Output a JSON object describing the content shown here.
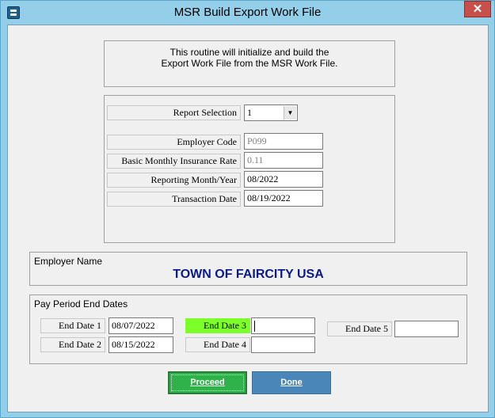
{
  "window": {
    "title": "MSR Build Export Work File",
    "close_glyph": "✕"
  },
  "info": {
    "line1": "This routine will initialize and build the",
    "line2": "Export Work File from the MSR Work File."
  },
  "form": {
    "report_selection": {
      "label": "Report Selection",
      "value": "1"
    },
    "employer_code": {
      "label": "Employer Code",
      "value": "P099"
    },
    "insurance_rate": {
      "label": "Basic Monthly Insurance Rate",
      "value": "0.11"
    },
    "reporting_month": {
      "label": "Reporting Month/Year",
      "value": "08/2022"
    },
    "transaction_date": {
      "label": "Transaction Date",
      "value": "08/19/2022"
    }
  },
  "employer": {
    "group_title": "Employer Name",
    "name": "TOWN OF FAIRCITY USA"
  },
  "pay_period": {
    "group_title": "Pay Period End Dates",
    "end_dates": [
      {
        "label": "End Date 1",
        "value": "08/07/2022"
      },
      {
        "label": "End Date 2",
        "value": "08/15/2022"
      },
      {
        "label": "End Date 3",
        "value": ""
      },
      {
        "label": "End Date 4",
        "value": ""
      },
      {
        "label": "End Date 5",
        "value": ""
      }
    ]
  },
  "buttons": {
    "proceed": "Proceed",
    "done": "Done"
  },
  "colors": {
    "highlight": "#7dff2a",
    "proceed": "#2fb24a",
    "done": "#4a87b8",
    "employer_name": "#0a1a8c"
  }
}
